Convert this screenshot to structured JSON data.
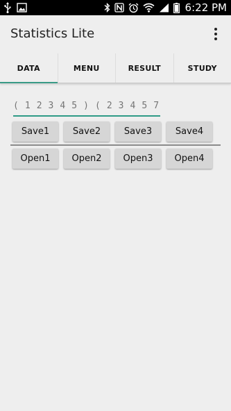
{
  "status_bar": {
    "time": "6:22 PM",
    "left_icons": [
      "usb-icon",
      "image-icon"
    ],
    "right_icons": [
      "bluetooth-icon",
      "nfc-icon",
      "alarm-icon",
      "wifi-icon",
      "signal-icon",
      "battery-icon"
    ]
  },
  "app_bar": {
    "title": "Statistics Lite",
    "overflow_icon": "more-vert-icon"
  },
  "tabs": [
    {
      "label": "DATA",
      "active": true
    },
    {
      "label": "MENU",
      "active": false
    },
    {
      "label": "RESULT",
      "active": false
    },
    {
      "label": "STUDY",
      "active": false
    }
  ],
  "data_input": {
    "placeholder": "( 1 2 3 4 5 ) ( 2 3 4 5 7 )"
  },
  "save_buttons": [
    "Save1",
    "Save2",
    "Save3",
    "Save4"
  ],
  "open_buttons": [
    "Open1",
    "Open2",
    "Open3",
    "Open4"
  ],
  "colors": {
    "accent": "#2e9a86",
    "background": "#eeeeee",
    "button": "#d6d6d6",
    "status_bar": "#000000"
  }
}
